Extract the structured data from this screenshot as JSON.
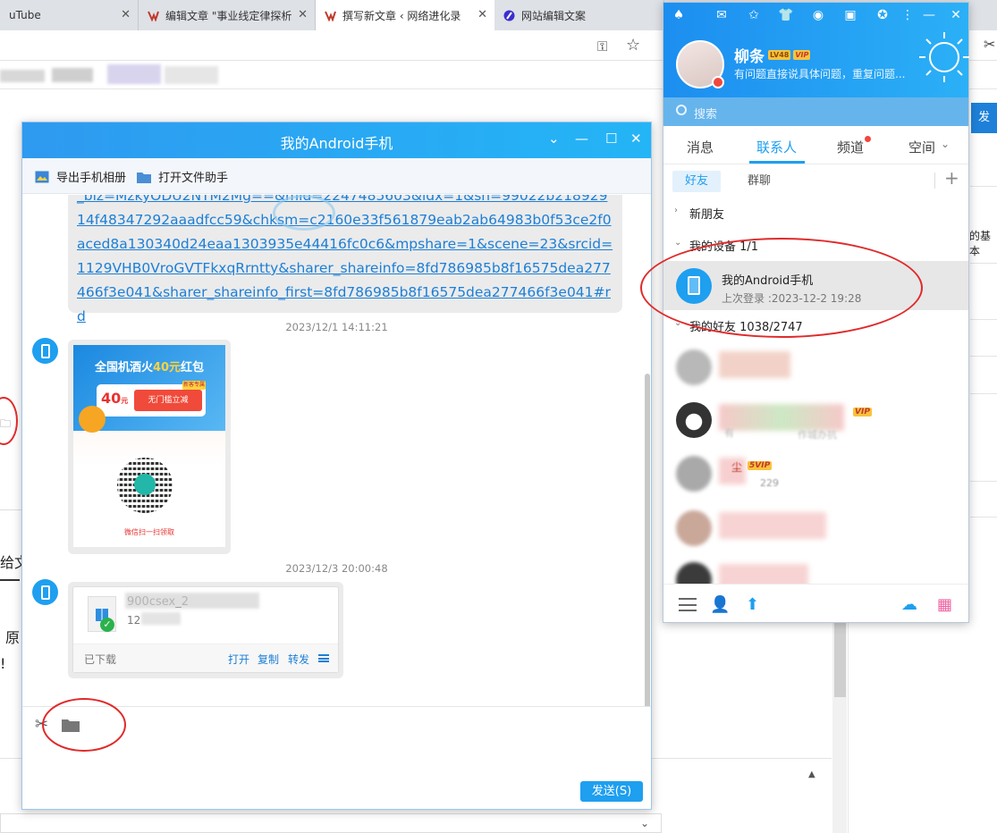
{
  "browser": {
    "tabs": [
      {
        "title": "uTube"
      },
      {
        "title": "编辑文章 \"事业线定律探析"
      },
      {
        "title": "撰写新文章 ‹ 网络进化录"
      },
      {
        "title": "网站编辑文案"
      }
    ]
  },
  "background_page": {
    "frag_give": "给文",
    "frag_yuan": "原",
    "frag_excl": "!",
    "frag_basic": "的基本",
    "publish_label": "发布"
  },
  "chat": {
    "title": "我的Android手机",
    "toolbar": {
      "export_album": "导出手机相册",
      "open_file_helper": "打开文件助手"
    },
    "link_text": "_biz=MzkyODU2NTM2Mg==&mid=2247485603&idx=1&sn=99022b21892914f48347292aaadfcc59&chksm=c2160e33f561879eab2ab64983b0f53ce2f0aced8a130340d24eaa1303935e44416fc0c6&mpshare=1&scene=23&srcid=1129VHB0VroGVTFkxqRrntty&sharer_shareinfo=8fd786985b8f16575dea277466f3e041&sharer_shareinfo_first=8fd786985b8f16575dea277466f3e041#rd",
    "timestamp_1": "2023/12/1 14:11:21",
    "timestamp_2": "2023/12/3 20:00:48",
    "poster": {
      "title_prefix": "全国机酒火",
      "title_amount": "40元",
      "title_suffix": "红包",
      "coupon_value": "40",
      "coupon_unit": "元",
      "coupon_button": "无门槛立减",
      "badge": "新客专属",
      "qr_caption": "微信扫一扫领取"
    },
    "file": {
      "name": "900csex_2",
      "size": "12",
      "state": "已下载",
      "action_open": "打开",
      "action_copy": "复制",
      "action_forward": "转发"
    },
    "send_label": "发送(S)"
  },
  "qq": {
    "name": "柳条",
    "level_badge": "LV48",
    "vip_badge": "VIP",
    "signature": "有问题直接说具体问题，重复问题...",
    "search_placeholder": "搜索",
    "tabs": [
      "消息",
      "联系人",
      "频道",
      "空间"
    ],
    "subtabs": [
      "好友",
      "群聊"
    ],
    "add_label": "+",
    "groups": {
      "new_friends": "新朋友",
      "my_devices": "我的设备",
      "my_devices_count": "1/1",
      "my_friends": "我的好友",
      "my_friends_count": "1038/2747"
    },
    "device": {
      "name": "我的Android手机",
      "last_login": "上次登录 :2023-12-2 19:28"
    },
    "friend_tags": [
      "VIP",
      "5VIP"
    ],
    "friend_text_1": "作城办抗",
    "friend_text_2": "有",
    "friend_text_3": "尘",
    "friend_text_4": "229"
  },
  "colors": {
    "accent": "#1e9ff0",
    "title_bar": "#2e9af0",
    "annotation": "#e02a2a"
  }
}
